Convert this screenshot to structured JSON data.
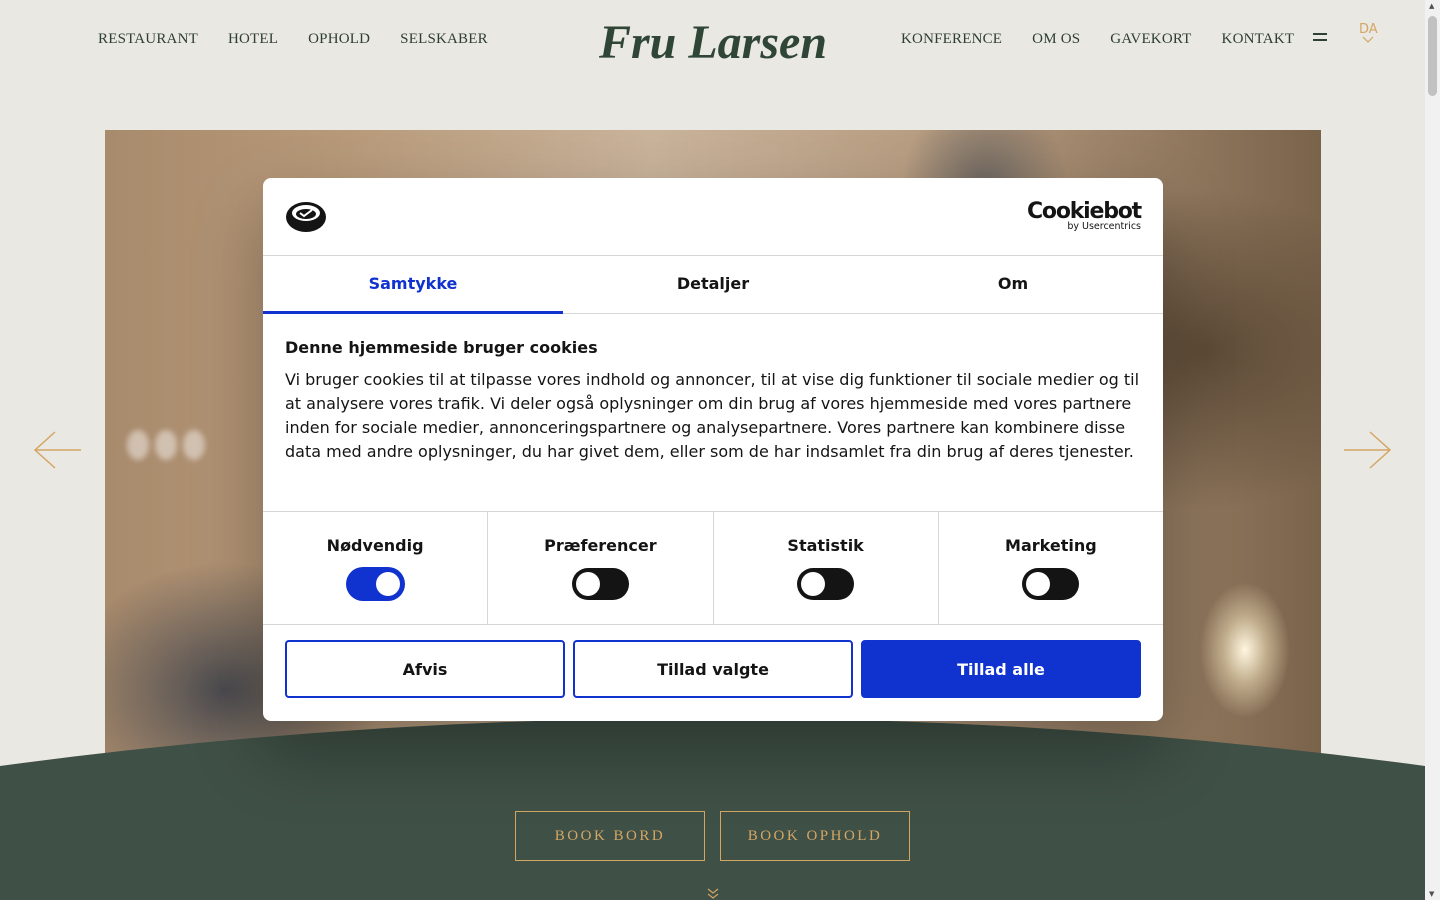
{
  "header": {
    "nav_left": [
      "RESTAURANT",
      "HOTEL",
      "OPHOLD",
      "SELSKABER"
    ],
    "nav_right": [
      "KONFERENCE",
      "OM OS",
      "GAVEKORT",
      "KONTAKT"
    ],
    "logo_text": "Fru Larsen",
    "language": "DA"
  },
  "hero": {
    "prev_icon": "arrow-left-icon",
    "next_icon": "arrow-right-icon"
  },
  "booking": {
    "book_bord": "BOOK BORD",
    "book_ophold": "BOOK OPHOLD"
  },
  "cookie_dialog": {
    "brand_name": "Cookiebot",
    "brand_by": "by Usercentrics",
    "tabs": [
      "Samtykke",
      "Detaljer",
      "Om"
    ],
    "active_tab": "Samtykke",
    "heading": "Denne hjemmeside bruger cookies",
    "body": "Vi bruger cookies til at tilpasse vores indhold og annoncer, til at vise dig funktioner til sociale medier og til at analysere vores trafik. Vi deler også oplysninger om din brug af vores hjemmeside med vores partnere inden for sociale medier, annonceringspartnere og analysepartnere. Vores partnere kan kombinere disse data med andre oplysninger, du har givet dem, eller som de har indsamlet fra din brug af deres tjenester.",
    "toggles": [
      {
        "label": "Nødvendig",
        "on": true
      },
      {
        "label": "Præferencer",
        "on": false
      },
      {
        "label": "Statistik",
        "on": false
      },
      {
        "label": "Marketing",
        "on": false
      }
    ],
    "buttons": {
      "deny": "Afvis",
      "allow_selected": "Tillad valgte",
      "allow_all": "Tillad alle"
    }
  },
  "colors": {
    "accent_blue": "#1032cf",
    "gold": "#d4a664",
    "forest_green": "#3f5046",
    "page_bg": "#eae8e3"
  }
}
